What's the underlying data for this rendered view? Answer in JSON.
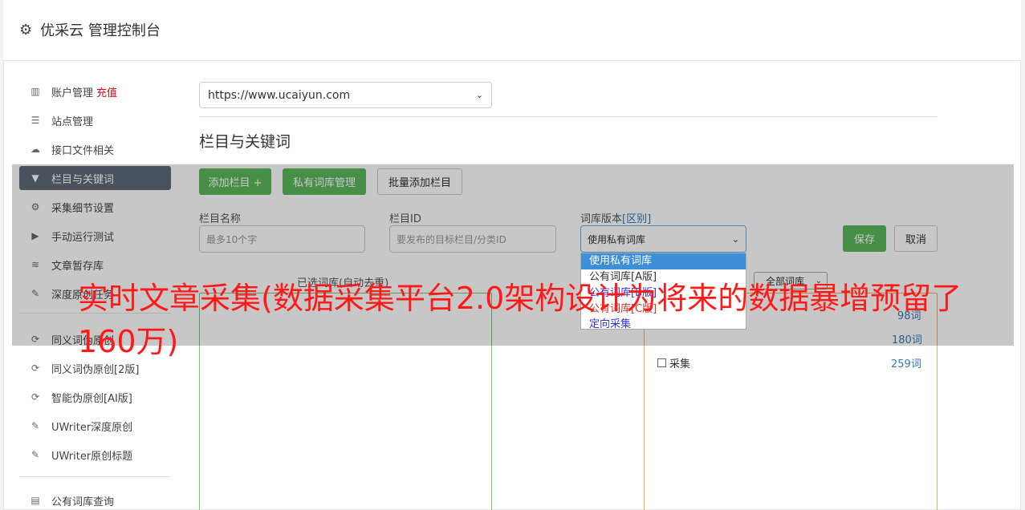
{
  "header": {
    "title": "优采云 管理控制台",
    "icon": "gear-icon"
  },
  "sidebar": {
    "items": [
      {
        "label": "账户管理",
        "badge": "充值",
        "icon": "bar-chart-icon"
      },
      {
        "label": "站点管理",
        "icon": "server-icon"
      },
      {
        "label": "接口文件相关",
        "icon": "cloud-upload-icon"
      },
      {
        "label": "栏目与关键词",
        "icon": "filter-icon"
      },
      {
        "label": "采集细节设置",
        "icon": "cogs-icon"
      },
      {
        "label": "手动运行测试",
        "icon": "play-circle-icon"
      },
      {
        "label": "文章暂存库",
        "icon": "database-icon"
      },
      {
        "label": "深度原创任务",
        "icon": "edit-icon"
      },
      {
        "label": "同义词伪原创",
        "icon": "refresh-icon"
      },
      {
        "label": "同义词伪原创[2版]",
        "icon": "refresh-icon"
      },
      {
        "label": "智能伪原创[AI版]",
        "icon": "refresh-icon"
      },
      {
        "label": "UWriter深度原创",
        "icon": "edit-icon"
      },
      {
        "label": "UWriter原创标题",
        "icon": "edit-icon"
      },
      {
        "label": "公有词库查询",
        "icon": "book-icon"
      }
    ],
    "active_index": 3
  },
  "site_select": {
    "value": "https://www.ucaiyun.com"
  },
  "section": {
    "title": "栏目与关键词"
  },
  "toolbar": {
    "add_column": "添加栏目 +",
    "private_lexicon": "私有词库管理",
    "batch_add": "批量添加栏目"
  },
  "form": {
    "name_label": "栏目名称",
    "name_placeholder": "最多10个字",
    "id_label": "栏目ID",
    "id_placeholder": "要发布的目标栏目/分类ID",
    "lexicon_label": "词库版本",
    "lexicon_link": "[区别]",
    "lexicon_value": "使用私有词库",
    "save": "保存",
    "cancel": "取消"
  },
  "lexicon_options": [
    "使用私有词库",
    "公有词库[A版]",
    "公有词库[B版]",
    "公有词库[C版]",
    "定向采集"
  ],
  "selected_box": {
    "label": "已选词库(自动去重)"
  },
  "right_box": {
    "filter_value": "全部词库",
    "counts": [
      "98词",
      "180词",
      "259词"
    ],
    "checkbox_label": "采集"
  },
  "headline": "实时文章采集(数据采集平台2.0架构设计为将来的数据暴增预留了160万)",
  "colors": {
    "green": "#5cb85c",
    "active_sidebar": "#5f6b78",
    "headline": "#ff1a1a",
    "link": "#337ab7"
  }
}
